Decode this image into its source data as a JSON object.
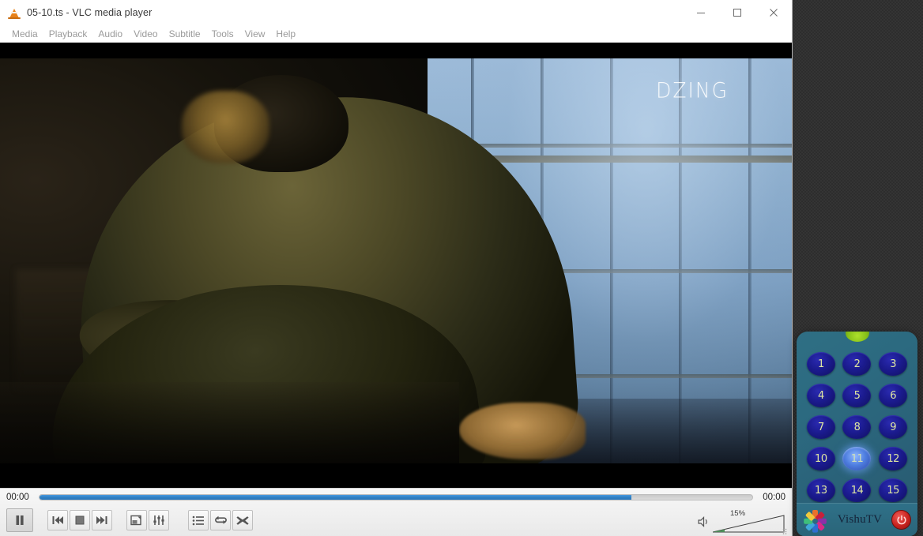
{
  "window": {
    "title": "05-10.ts - VLC media player",
    "app_icon": "vlc-cone-icon",
    "controls": {
      "minimize": "minimize-icon",
      "maximize": "maximize-icon",
      "close": "close-icon"
    }
  },
  "menubar": {
    "items": [
      {
        "label": "Media"
      },
      {
        "label": "Playback"
      },
      {
        "label": "Audio"
      },
      {
        "label": "Video"
      },
      {
        "label": "Subtitle"
      },
      {
        "label": "Tools"
      },
      {
        "label": "View"
      },
      {
        "label": "Help"
      }
    ]
  },
  "video": {
    "watermark": "DZING"
  },
  "controls": {
    "time_elapsed": "00:00",
    "time_total": "00:00",
    "progress_percent": 83,
    "buttons": [
      {
        "name": "play-pause-button",
        "label": "Pause"
      },
      {
        "name": "previous-button",
        "label": "Previous"
      },
      {
        "name": "stop-button",
        "label": "Stop"
      },
      {
        "name": "next-button",
        "label": "Next"
      },
      {
        "name": "fullscreen-button",
        "label": "Toggle fullscreen"
      },
      {
        "name": "extended-settings-button",
        "label": "Show extended settings"
      },
      {
        "name": "playlist-button",
        "label": "Show playlist"
      },
      {
        "name": "loop-button",
        "label": "Loop"
      },
      {
        "name": "shuffle-button",
        "label": "Random"
      }
    ],
    "volume": {
      "level_label": "15%",
      "level_percent": 15,
      "speaker_icon": "speaker-icon"
    },
    "accent_color": "#2f7fc4"
  },
  "remote": {
    "brand": "VishuTV",
    "led_color": "#8ec81a",
    "panel_color": "#2c6a80",
    "key_color": "#1b1b8e",
    "key_active_color": "#4f7fe0",
    "power_color": "#c8231f",
    "active_channel": "11",
    "channels": [
      "1",
      "2",
      "3",
      "4",
      "5",
      "6",
      "7",
      "8",
      "9",
      "10",
      "11",
      "12",
      "13",
      "14",
      "15"
    ],
    "power_label": "Power"
  }
}
